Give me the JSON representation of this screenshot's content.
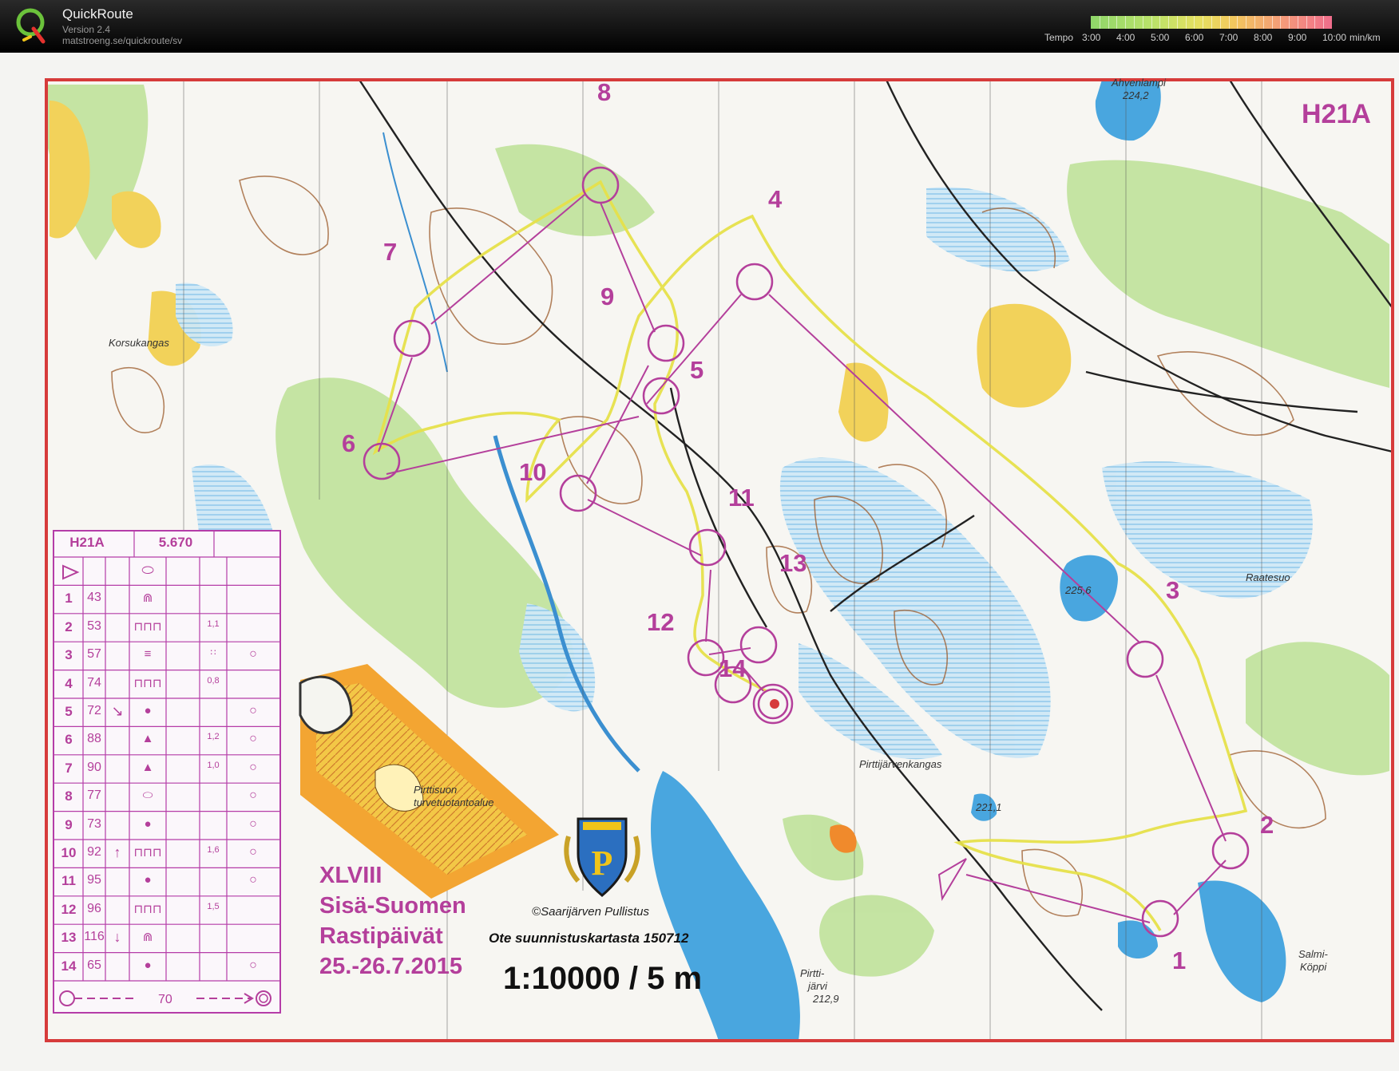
{
  "app": {
    "name": "QuickRoute",
    "version": "Version 2.4",
    "url": "matstroeng.se/quickroute/sv"
  },
  "tempo": {
    "label": "Tempo",
    "ticks": [
      "3:00",
      "4:00",
      "5:00",
      "6:00",
      "7:00",
      "8:00",
      "9:00",
      "10:00"
    ],
    "unit": "min/km"
  },
  "map": {
    "class": "H21A",
    "title_lines": [
      "XLVIII",
      "Sisä-Suomen",
      "Rastipäivät",
      "25.-26.7.2015"
    ],
    "copyright": "Saarijärven Pullistus",
    "extract": "Ote suunnistuskartasta 150712",
    "scale": "1:10000 / 5 m",
    "places": {
      "korsukangas": "Korsukangas",
      "ahvenlampi": "Ahvenlampi",
      "ahvenlampi_h": "224,2",
      "raatesuo": "Raatesuo",
      "pond1": "225,6",
      "pond2": "221,1",
      "pirttijarvenkangas": "Pirttijärvenkangas",
      "pirttisuo1": "Pirttisuon",
      "pirttisuo2": "turvetuotantoalue",
      "pirttijarvi1": "Pirtti-",
      "pirttijarvi2": "järvi",
      "pirttijarvi3": "212,9",
      "salmi1": "Salmi-",
      "salmi2": "Köppi"
    },
    "controls": [
      {
        "n": "1"
      },
      {
        "n": "2"
      },
      {
        "n": "3"
      },
      {
        "n": "4"
      },
      {
        "n": "5"
      },
      {
        "n": "6"
      },
      {
        "n": "7"
      },
      {
        "n": "8"
      },
      {
        "n": "9"
      },
      {
        "n": "10"
      },
      {
        "n": "11"
      },
      {
        "n": "12"
      },
      {
        "n": "13"
      },
      {
        "n": "14"
      }
    ],
    "colors": {
      "course": "#b43f9b",
      "frame": "#d63b3b",
      "water": "#4fa9e0",
      "marsh": "#bfe0f4",
      "green": "#b7dd8a",
      "yellow": "#f1cf55",
      "contour": "#9b5a2a",
      "route": "#e6e04a"
    }
  },
  "description": {
    "class": "H21A",
    "length": "5.670",
    "rows": [
      {
        "n": "1",
        "code": "43",
        "sym": "⋒",
        "dim": "",
        "extra": ""
      },
      {
        "n": "2",
        "code": "53",
        "sym": "⊓⊓⊓",
        "dim": "1,1",
        "extra": ""
      },
      {
        "n": "3",
        "code": "57",
        "sym": "≡",
        "dim": "∷",
        "extra": "○"
      },
      {
        "n": "4",
        "code": "74",
        "sym": "⊓⊓⊓",
        "dim": "0,8",
        "extra": ""
      },
      {
        "n": "5",
        "code": "72",
        "sym": "●",
        "dim": "",
        "extra": "○"
      },
      {
        "n": "6",
        "code": "88",
        "sym": "▲",
        "dim": "1,2",
        "extra": "○"
      },
      {
        "n": "7",
        "code": "90",
        "sym": "▲",
        "dim": "1,0",
        "extra": "○"
      },
      {
        "n": "8",
        "code": "77",
        "sym": "⬭",
        "dim": "",
        "extra": "○"
      },
      {
        "n": "9",
        "code": "73",
        "sym": "●",
        "dim": "",
        "extra": "○"
      },
      {
        "n": "10",
        "code": "92",
        "sym": "⊓⊓⊓",
        "dim": "1,6",
        "extra": "○"
      },
      {
        "n": "11",
        "code": "95",
        "sym": "●",
        "dim": "",
        "extra": "○"
      },
      {
        "n": "12",
        "code": "96",
        "sym": "⊓⊓⊓",
        "dim": "1,5",
        "extra": ""
      },
      {
        "n": "13",
        "code": "116",
        "sym": "⋒",
        "dim": "",
        "extra": ""
      },
      {
        "n": "14",
        "code": "65",
        "sym": "●",
        "dim": "",
        "extra": "○"
      }
    ],
    "arrows": {
      "5": "↘",
      "10": "↑",
      "13": "↓"
    },
    "finish_distance": "70"
  }
}
